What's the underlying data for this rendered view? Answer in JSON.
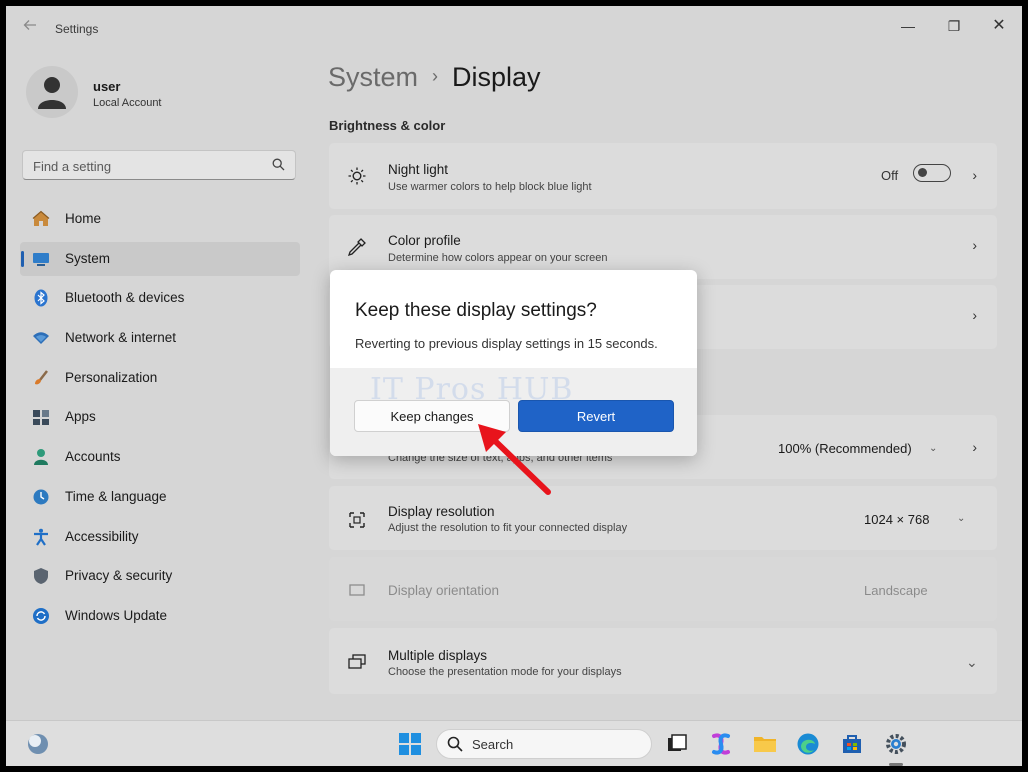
{
  "window": {
    "title": "Settings",
    "controls": {
      "minimize": "—",
      "maximize": "❐",
      "close": "✕"
    }
  },
  "user": {
    "name": "user",
    "account": "Local Account"
  },
  "search": {
    "placeholder": "Find a setting"
  },
  "sidebar": {
    "items": [
      {
        "label": "Home",
        "icon": "home-icon"
      },
      {
        "label": "System",
        "icon": "system-icon",
        "active": true
      },
      {
        "label": "Bluetooth & devices",
        "icon": "bluetooth-icon"
      },
      {
        "label": "Network & internet",
        "icon": "network-icon"
      },
      {
        "label": "Personalization",
        "icon": "personalization-icon"
      },
      {
        "label": "Apps",
        "icon": "apps-icon"
      },
      {
        "label": "Accounts",
        "icon": "accounts-icon"
      },
      {
        "label": "Time & language",
        "icon": "time-language-icon"
      },
      {
        "label": "Accessibility",
        "icon": "accessibility-icon"
      },
      {
        "label": "Privacy & security",
        "icon": "privacy-icon"
      },
      {
        "label": "Windows Update",
        "icon": "windows-update-icon"
      }
    ]
  },
  "breadcrumb": {
    "parent": "System",
    "separator": "›",
    "current": "Display"
  },
  "section": {
    "brightness_title": "Brightness & color"
  },
  "cards": {
    "night_light": {
      "title": "Night light",
      "desc": "Use warmer colors to help block blue light",
      "state": "Off"
    },
    "color_profile": {
      "title": "Color profile",
      "desc": "Determine how colors appear on your screen"
    },
    "scale": {
      "desc": "Change the size of text, apps, and other items",
      "value": "100% (Recommended)"
    },
    "resolution": {
      "title": "Display resolution",
      "desc": "Adjust the resolution to fit your connected display",
      "value": "1024 × 768"
    },
    "orientation": {
      "title": "Display orientation",
      "value": "Landscape"
    },
    "multiple": {
      "title": "Multiple displays",
      "desc": "Choose the presentation mode for your displays"
    }
  },
  "dialog": {
    "title": "Keep these display settings?",
    "message": "Reverting to previous display settings in 15 seconds.",
    "keep_label": "Keep changes",
    "revert_label": "Revert",
    "watermark": "IT Pros HUB"
  },
  "taskbar": {
    "search_label": "Search",
    "icons": [
      "widgets-icon",
      "start-icon",
      "search-icon",
      "task-view-icon",
      "copilot-icon",
      "file-explorer-icon",
      "edge-icon",
      "store-icon",
      "settings-icon"
    ]
  },
  "colors": {
    "accent": "#1f63c7",
    "arrow": "#e8141c",
    "background": "#d6d6d6"
  }
}
